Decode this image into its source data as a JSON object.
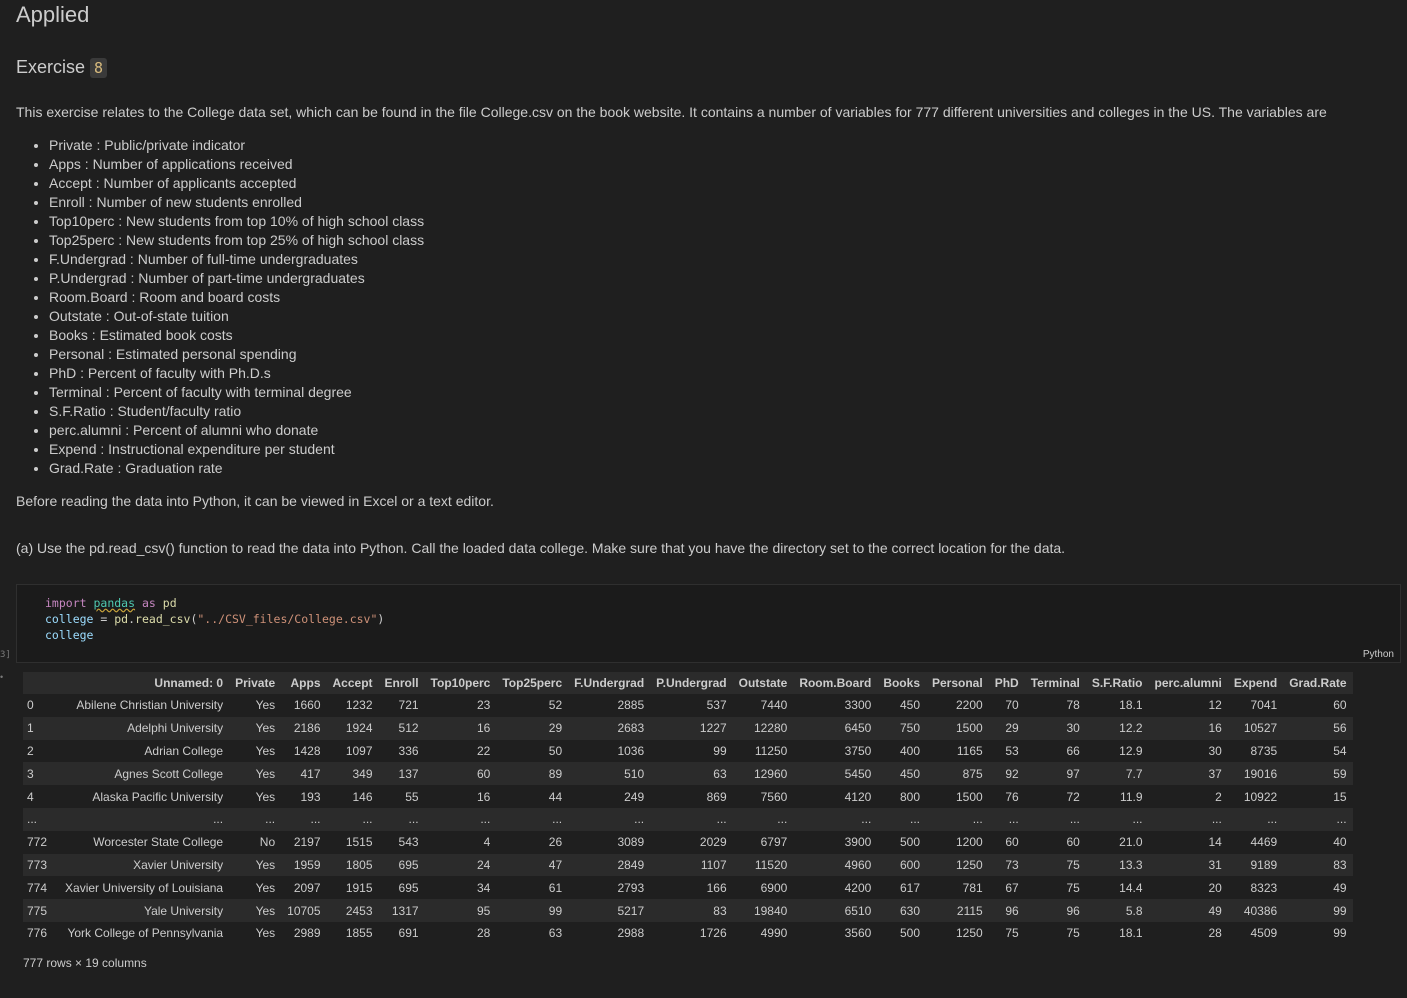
{
  "heading": "Applied",
  "exercise": {
    "label": "Exercise",
    "number": "8"
  },
  "intro": "This exercise relates to the College data set, which can be found in the file College.csv on the book website. It contains a number of variables for 777 different universities and colleges in the US. The variables are",
  "variables": [
    "Private : Public/private indicator",
    "Apps : Number of applications received",
    "Accept : Number of applicants accepted",
    "Enroll : Number of new students enrolled",
    "Top10perc : New students from top 10% of high school class",
    "Top25perc : New students from top 25% of high school class",
    "F.Undergrad : Number of full-time undergraduates",
    "P.Undergrad : Number of part-time undergraduates",
    "Room.Board : Room and board costs",
    "Outstate : Out-of-state tuition",
    "Books : Estimated book costs",
    "Personal : Estimated personal spending",
    "PhD : Percent of faculty with Ph.D.s",
    "Terminal : Percent of faculty with terminal degree",
    "S.F.Ratio : Student/faculty ratio",
    "perc.alumni : Percent of alumni who donate",
    "Expend : Instructional expenditure per student",
    "Grad.Rate : Graduation rate"
  ],
  "before_reading": "Before reading the data into Python, it can be viewed in Excel or a text editor.",
  "part_a": "(a) Use the pd.read_csv() function to read the data into Python. Call the loaded data college. Make sure that you have the directory set to the correct location for the data.",
  "code_cell": {
    "language": "Python",
    "gutter_label": "3]",
    "lines": [
      "import pandas as pd",
      "college = pd.read_csv(\"../CSV_files/College.csv\")",
      "college"
    ]
  },
  "output": {
    "columns": [
      "",
      "Unnamed: 0",
      "Private",
      "Apps",
      "Accept",
      "Enroll",
      "Top10perc",
      "Top25perc",
      "F.Undergrad",
      "P.Undergrad",
      "Outstate",
      "Room.Board",
      "Books",
      "Personal",
      "PhD",
      "Terminal",
      "S.F.Ratio",
      "perc.alumni",
      "Expend",
      "Grad.Rate"
    ],
    "rows": [
      [
        "0",
        "Abilene Christian University",
        "Yes",
        "1660",
        "1232",
        "721",
        "23",
        "52",
        "2885",
        "537",
        "7440",
        "3300",
        "450",
        "2200",
        "70",
        "78",
        "18.1",
        "12",
        "7041",
        "60"
      ],
      [
        "1",
        "Adelphi University",
        "Yes",
        "2186",
        "1924",
        "512",
        "16",
        "29",
        "2683",
        "1227",
        "12280",
        "6450",
        "750",
        "1500",
        "29",
        "30",
        "12.2",
        "16",
        "10527",
        "56"
      ],
      [
        "2",
        "Adrian College",
        "Yes",
        "1428",
        "1097",
        "336",
        "22",
        "50",
        "1036",
        "99",
        "11250",
        "3750",
        "400",
        "1165",
        "53",
        "66",
        "12.9",
        "30",
        "8735",
        "54"
      ],
      [
        "3",
        "Agnes Scott College",
        "Yes",
        "417",
        "349",
        "137",
        "60",
        "89",
        "510",
        "63",
        "12960",
        "5450",
        "450",
        "875",
        "92",
        "97",
        "7.7",
        "37",
        "19016",
        "59"
      ],
      [
        "4",
        "Alaska Pacific University",
        "Yes",
        "193",
        "146",
        "55",
        "16",
        "44",
        "249",
        "869",
        "7560",
        "4120",
        "800",
        "1500",
        "76",
        "72",
        "11.9",
        "2",
        "10922",
        "15"
      ],
      [
        "...",
        "...",
        "...",
        "...",
        "...",
        "...",
        "...",
        "...",
        "...",
        "...",
        "...",
        "...",
        "...",
        "...",
        "...",
        "...",
        "...",
        "...",
        "...",
        "..."
      ],
      [
        "772",
        "Worcester State College",
        "No",
        "2197",
        "1515",
        "543",
        "4",
        "26",
        "3089",
        "2029",
        "6797",
        "3900",
        "500",
        "1200",
        "60",
        "60",
        "21.0",
        "14",
        "4469",
        "40"
      ],
      [
        "773",
        "Xavier University",
        "Yes",
        "1959",
        "1805",
        "695",
        "24",
        "47",
        "2849",
        "1107",
        "11520",
        "4960",
        "600",
        "1250",
        "73",
        "75",
        "13.3",
        "31",
        "9189",
        "83"
      ],
      [
        "774",
        "Xavier University of Louisiana",
        "Yes",
        "2097",
        "1915",
        "695",
        "34",
        "61",
        "2793",
        "166",
        "6900",
        "4200",
        "617",
        "781",
        "67",
        "75",
        "14.4",
        "20",
        "8323",
        "49"
      ],
      [
        "775",
        "Yale University",
        "Yes",
        "10705",
        "2453",
        "1317",
        "95",
        "99",
        "5217",
        "83",
        "19840",
        "6510",
        "630",
        "2115",
        "96",
        "96",
        "5.8",
        "49",
        "40386",
        "99"
      ],
      [
        "776",
        "York College of Pennsylvania",
        "Yes",
        "2989",
        "1855",
        "691",
        "28",
        "63",
        "2988",
        "1726",
        "4990",
        "3560",
        "500",
        "1250",
        "75",
        "75",
        "18.1",
        "28",
        "4509",
        "99"
      ]
    ],
    "shape_text": "777 rows × 19 columns"
  }
}
